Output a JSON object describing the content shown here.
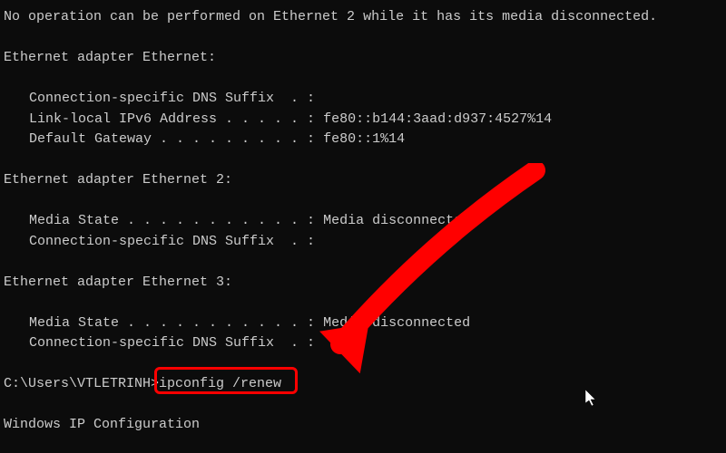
{
  "error_line": "No operation can be performed on Ethernet 2 while it has its media disconnected.",
  "adapters": [
    {
      "header": "Ethernet adapter Ethernet:",
      "rows": [
        {
          "label": "Connection-specific DNS Suffix  . :",
          "value": ""
        },
        {
          "label": "Link-local IPv6 Address . . . . . :",
          "value": " fe80::b144:3aad:d937:4527%14"
        },
        {
          "label": "Default Gateway . . . . . . . . . :",
          "value": " fe80::1%14"
        }
      ]
    },
    {
      "header": "Ethernet adapter Ethernet 2:",
      "rows": [
        {
          "label": "Media State . . . . . . . . . . . :",
          "value": " Media disconnected"
        },
        {
          "label": "Connection-specific DNS Suffix  . :",
          "value": ""
        }
      ]
    },
    {
      "header": "Ethernet adapter Ethernet 3:",
      "rows": [
        {
          "label": "Media State . . . . . . . . . . . :",
          "value": " Media disconnected"
        },
        {
          "label": "Connection-specific DNS Suffix  . :",
          "value": ""
        }
      ]
    }
  ],
  "prompt": "C:\\Users\\VTLETRINH>",
  "command": "ipconfig /renew",
  "result_heading": "Windows IP Configuration",
  "annotation": {
    "highlight_color": "#ff0000",
    "arrow_color": "#ff0000"
  }
}
